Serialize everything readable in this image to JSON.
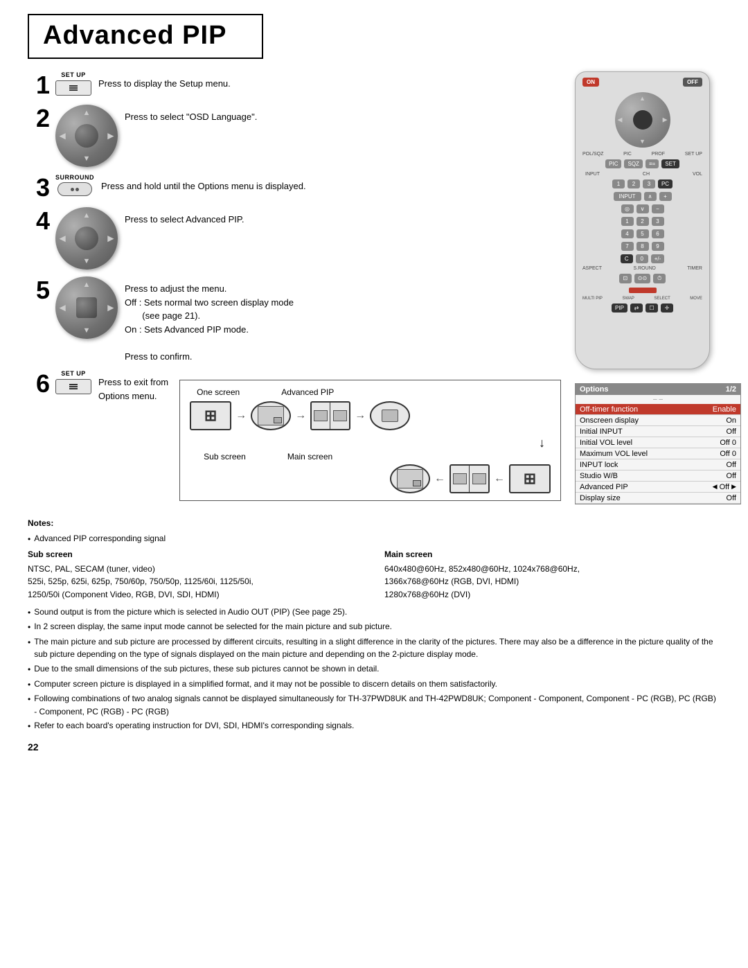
{
  "title": "Advanced PIP",
  "steps": [
    {
      "number": "1",
      "button_label": "SET UP",
      "text": "Press to display the Setup menu."
    },
    {
      "number": "2",
      "text": "Press to select \"OSD Language\"."
    },
    {
      "number": "3",
      "button_label": "SURROUND",
      "text": "Press and hold until the Options menu is displayed."
    },
    {
      "number": "4",
      "text": "Press to select Advanced PIP."
    },
    {
      "number": "5",
      "text_lines": [
        "Press to adjust the menu.",
        "Off : Sets normal two screen display mode",
        "       (see page 21).",
        "On : Sets Advanced PIP mode.",
        "",
        "Press to confirm."
      ]
    },
    {
      "number": "6",
      "button_label": "SET UP",
      "text_lines": [
        "Press to exit from",
        "Options menu."
      ]
    }
  ],
  "options_panel": {
    "header_left": "Options",
    "header_right": "1/2",
    "dash": "– –",
    "rows": [
      {
        "label": "Off-timer function",
        "value": "Enable",
        "highlight": true
      },
      {
        "label": "Onscreen display",
        "value": "On"
      },
      {
        "label": "Initial INPUT",
        "value": "Off"
      },
      {
        "label": "Initial VOL level",
        "value": "Off   0"
      },
      {
        "label": "Maximum VOL level",
        "value": "Off   0"
      },
      {
        "label": "INPUT lock",
        "value": "Off"
      },
      {
        "label": "Studio W/B",
        "value": "Off"
      },
      {
        "label": "Advanced PIP",
        "value": "Off",
        "arrows": true
      },
      {
        "label": "Display size",
        "value": "Off"
      }
    ]
  },
  "flow_diagram": {
    "top_labels": [
      "One screen",
      "Advanced PIP"
    ],
    "bottom_labels": [
      "Sub screen",
      "Main screen"
    ]
  },
  "notes": {
    "title": "Notes:",
    "bullet1": "Advanced PIP corresponding signal",
    "sub_screen_label": "Sub screen",
    "sub_screen_text": "NTSC, PAL, SECAM (tuner, video)\n525i, 525p, 625i, 625p, 750/60p, 750/50p, 1125/60i, 1125/50i,\n1250/50i (Component Video, RGB, DVI, SDI, HDMI)",
    "main_screen_label": "Main screen",
    "main_screen_text": "640x480@60Hz, 852x480@60Hz, 1024x768@60Hz,\n1366x768@60Hz (RGB, DVI, HDMI)\n1280x768@60Hz (DVI)",
    "bullets": [
      "Sound output is from the picture which is selected in Audio OUT (PIP) (See page 25).",
      "In 2 screen display, the same input mode cannot be selected for the main picture and sub picture.",
      "The main picture and sub picture are processed by different circuits, resulting in a slight difference in the clarity of the pictures. There may also be a difference in the picture quality of the sub picture depending on the type of signals displayed on the main picture and depending on the 2-picture display mode.",
      "Due to the small dimensions of the sub pictures, these sub pictures cannot be shown in detail.",
      "Computer screen picture is displayed in a simplified format, and it may not be possible to discern details on them satisfactorily.",
      "Following combinations of two analog signals cannot be displayed simultaneously for TH-37PWD8UK and TH-42PWD8UK; Component - Component, Component - PC (RGB), PC (RGB) - Component, PC (RGB) - PC (RGB)",
      "Refer to each board's operating instruction for DVI, SDI, HDMI's corresponding signals."
    ]
  },
  "page_number": "22"
}
